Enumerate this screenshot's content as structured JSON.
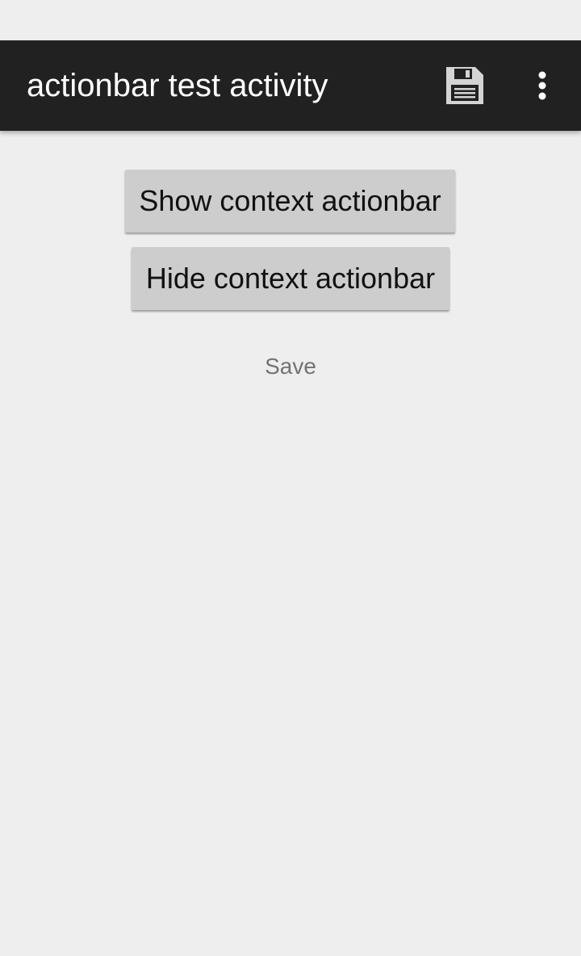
{
  "action_bar": {
    "title": "actionbar test activity",
    "background_color": "#212121",
    "actions": {
      "save_icon": "floppy-disk-icon",
      "overflow_icon": "vertical-ellipsis-icon"
    }
  },
  "content": {
    "show_button_label": "Show context actionbar",
    "hide_button_label": "Hide context actionbar",
    "status_text": "Save"
  },
  "colors": {
    "background": "#eeeeee",
    "button": "#cdcdcd",
    "status_text": "#737373"
  }
}
